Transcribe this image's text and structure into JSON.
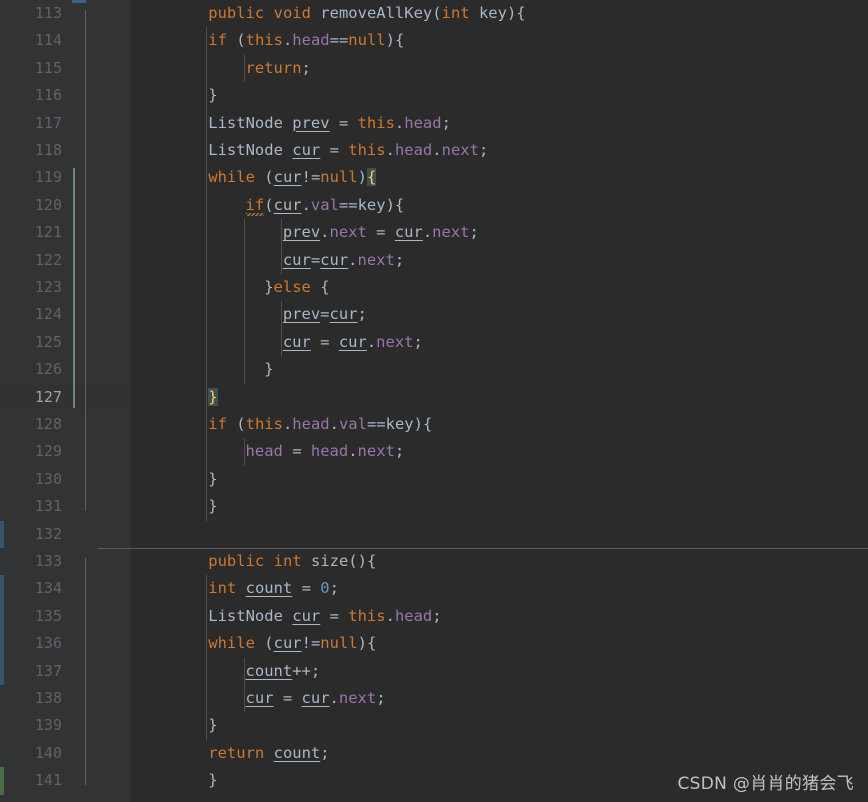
{
  "editor": {
    "app": "code-editor",
    "theme": "darcula",
    "font_size_px": 15.5,
    "line_height_px": 27.4,
    "first_line": 113,
    "last_line": 141,
    "current_line": 127,
    "colors": {
      "background": "#2b2b2b",
      "gutter_background": "#313335",
      "current_line_background": "#323232",
      "line_number": "#606366",
      "line_number_active": "#a4a3a3",
      "keyword": "#cc7832",
      "identifier": "#a9b7c6",
      "field": "#9876aa",
      "number": "#6897bb",
      "brace_match_bg": "#3b514d",
      "brace_match_fg": "#ffc66d",
      "indent_guide": "#4b4f52",
      "method_separator": "#5a5c5e",
      "change_marker_blue": "#385570",
      "change_marker_green": "#4a6b41",
      "watermark": "#cfcfcf"
    }
  },
  "watermark": {
    "text": "CSDN @肖肖的猪会飞"
  },
  "lines": [
    {
      "number": 113,
      "indent": 4,
      "fold": "start",
      "text": "public void removeAllKey(int key){",
      "tokens": [
        {
          "t": "public",
          "c": "kw"
        },
        {
          "t": " ",
          "c": "punct"
        },
        {
          "t": "void",
          "c": "kw"
        },
        {
          "t": " ",
          "c": "punct"
        },
        {
          "t": "removeAllKey",
          "c": "method"
        },
        {
          "t": "(",
          "c": "punct"
        },
        {
          "t": "int",
          "c": "kw"
        },
        {
          "t": " ",
          "c": "punct"
        },
        {
          "t": "key",
          "c": "param"
        },
        {
          "t": "){",
          "c": "punct"
        }
      ]
    },
    {
      "number": 114,
      "indent": 4,
      "fold": "start",
      "text": "if (this.head==null){",
      "tokens": [
        {
          "t": "if",
          "c": "kw"
        },
        {
          "t": " (",
          "c": "punct"
        },
        {
          "t": "this",
          "c": "kw"
        },
        {
          "t": ".",
          "c": "punct"
        },
        {
          "t": "head",
          "c": "field"
        },
        {
          "t": "==",
          "c": "punct"
        },
        {
          "t": "null",
          "c": "kw"
        },
        {
          "t": "){",
          "c": "punct"
        }
      ]
    },
    {
      "number": 115,
      "indent": 8,
      "fold": "none",
      "text": "return;",
      "tokens": [
        {
          "t": "return",
          "c": "kw"
        },
        {
          "t": ";",
          "c": "punct"
        }
      ]
    },
    {
      "number": 116,
      "indent": 4,
      "fold": "end",
      "text": "}",
      "tokens": [
        {
          "t": "}",
          "c": "punct"
        }
      ]
    },
    {
      "number": 117,
      "indent": 4,
      "fold": "none",
      "text": "ListNode prev = this.head;",
      "tokens": [
        {
          "t": "ListNode",
          "c": "type"
        },
        {
          "t": " ",
          "c": "punct"
        },
        {
          "t": "prev",
          "c": "localvar"
        },
        {
          "t": " = ",
          "c": "punct"
        },
        {
          "t": "this",
          "c": "kw"
        },
        {
          "t": ".",
          "c": "punct"
        },
        {
          "t": "head",
          "c": "field"
        },
        {
          "t": ";",
          "c": "punct"
        }
      ]
    },
    {
      "number": 118,
      "indent": 4,
      "fold": "none",
      "text": "ListNode cur = this.head.next;",
      "tokens": [
        {
          "t": "ListNode",
          "c": "type"
        },
        {
          "t": " ",
          "c": "punct"
        },
        {
          "t": "cur",
          "c": "localvar"
        },
        {
          "t": " = ",
          "c": "punct"
        },
        {
          "t": "this",
          "c": "kw"
        },
        {
          "t": ".",
          "c": "punct"
        },
        {
          "t": "head",
          "c": "field"
        },
        {
          "t": ".",
          "c": "punct"
        },
        {
          "t": "next",
          "c": "field"
        },
        {
          "t": ";",
          "c": "punct"
        }
      ]
    },
    {
      "number": 119,
      "indent": 4,
      "fold": "start",
      "text": "while (cur!=null){",
      "tokens": [
        {
          "t": "while",
          "c": "kw"
        },
        {
          "t": " (",
          "c": "punct"
        },
        {
          "t": "cur",
          "c": "localvar"
        },
        {
          "t": "!=",
          "c": "punct"
        },
        {
          "t": "null",
          "c": "kw"
        },
        {
          "t": ")",
          "c": "punct"
        },
        {
          "t": "{",
          "c": "brace-hl"
        }
      ]
    },
    {
      "number": 120,
      "indent": 8,
      "fold": "start",
      "text": "if(cur.val==key){",
      "tokens": [
        {
          "t": "if",
          "c": "warn"
        },
        {
          "t": "(",
          "c": "punct"
        },
        {
          "t": "cur",
          "c": "localvar"
        },
        {
          "t": ".",
          "c": "punct"
        },
        {
          "t": "val",
          "c": "field"
        },
        {
          "t": "==",
          "c": "punct"
        },
        {
          "t": "key",
          "c": "param"
        },
        {
          "t": "){",
          "c": "punct"
        }
      ]
    },
    {
      "number": 121,
      "indent": 12,
      "fold": "none",
      "text": "prev.next = cur.next;",
      "tokens": [
        {
          "t": "prev",
          "c": "localvar"
        },
        {
          "t": ".",
          "c": "punct"
        },
        {
          "t": "next",
          "c": "field"
        },
        {
          "t": " = ",
          "c": "punct"
        },
        {
          "t": "cur",
          "c": "localvar"
        },
        {
          "t": ".",
          "c": "punct"
        },
        {
          "t": "next",
          "c": "field"
        },
        {
          "t": ";",
          "c": "punct"
        }
      ]
    },
    {
      "number": 122,
      "indent": 12,
      "fold": "none",
      "text": "cur=cur.next;",
      "tokens": [
        {
          "t": "cur",
          "c": "localvar"
        },
        {
          "t": "=",
          "c": "punct"
        },
        {
          "t": "cur",
          "c": "localvar"
        },
        {
          "t": ".",
          "c": "punct"
        },
        {
          "t": "next",
          "c": "field"
        },
        {
          "t": ";",
          "c": "punct"
        }
      ]
    },
    {
      "number": 123,
      "indent": 10,
      "fold": "end",
      "text": "}else {",
      "tokens": [
        {
          "t": "}",
          "c": "punct"
        },
        {
          "t": "else",
          "c": "kw"
        },
        {
          "t": " {",
          "c": "punct"
        }
      ]
    },
    {
      "number": 124,
      "indent": 12,
      "fold": "none",
      "text": "prev=cur;",
      "tokens": [
        {
          "t": "prev",
          "c": "localvar"
        },
        {
          "t": "=",
          "c": "punct"
        },
        {
          "t": "cur",
          "c": "localvar"
        },
        {
          "t": ";",
          "c": "punct"
        }
      ]
    },
    {
      "number": 125,
      "indent": 12,
      "fold": "none",
      "text": "cur = cur.next;",
      "tokens": [
        {
          "t": "cur",
          "c": "localvar"
        },
        {
          "t": " = ",
          "c": "punct"
        },
        {
          "t": "cur",
          "c": "localvar"
        },
        {
          "t": ".",
          "c": "punct"
        },
        {
          "t": "next",
          "c": "field"
        },
        {
          "t": ";",
          "c": "punct"
        }
      ]
    },
    {
      "number": 126,
      "indent": 10,
      "fold": "end",
      "text": "}",
      "tokens": [
        {
          "t": "}",
          "c": "punct"
        }
      ]
    },
    {
      "number": 127,
      "indent": 4,
      "fold": "end",
      "current": true,
      "text": "}",
      "tokens": [
        {
          "t": "}",
          "c": "brace-hl"
        }
      ]
    },
    {
      "number": 128,
      "indent": 4,
      "fold": "start",
      "text": "if (this.head.val==key){",
      "tokens": [
        {
          "t": "if",
          "c": "kw"
        },
        {
          "t": " (",
          "c": "punct"
        },
        {
          "t": "this",
          "c": "kw"
        },
        {
          "t": ".",
          "c": "punct"
        },
        {
          "t": "head",
          "c": "field"
        },
        {
          "t": ".",
          "c": "punct"
        },
        {
          "t": "val",
          "c": "field"
        },
        {
          "t": "==",
          "c": "punct"
        },
        {
          "t": "key",
          "c": "param"
        },
        {
          "t": "){",
          "c": "punct"
        }
      ]
    },
    {
      "number": 129,
      "indent": 8,
      "fold": "none",
      "text": "head = head.next;",
      "tokens": [
        {
          "t": "head",
          "c": "field"
        },
        {
          "t": " = ",
          "c": "punct"
        },
        {
          "t": "head",
          "c": "field"
        },
        {
          "t": ".",
          "c": "punct"
        },
        {
          "t": "next",
          "c": "field"
        },
        {
          "t": ";",
          "c": "punct"
        }
      ]
    },
    {
      "number": 130,
      "indent": 4,
      "fold": "end",
      "text": "}",
      "tokens": [
        {
          "t": "}",
          "c": "punct"
        }
      ]
    },
    {
      "number": 131,
      "indent": 4,
      "fold": "end",
      "text": "}",
      "tokens": [
        {
          "t": "}",
          "c": "punct"
        }
      ]
    },
    {
      "number": 132,
      "indent": 0,
      "fold": "none",
      "change": "blue",
      "text": "",
      "tokens": []
    },
    {
      "number": 133,
      "indent": 4,
      "fold": "start",
      "separator_above": true,
      "text": "public int size(){",
      "tokens": [
        {
          "t": "public",
          "c": "kw"
        },
        {
          "t": " ",
          "c": "punct"
        },
        {
          "t": "int",
          "c": "kw"
        },
        {
          "t": " ",
          "c": "punct"
        },
        {
          "t": "size",
          "c": "method"
        },
        {
          "t": "(){",
          "c": "punct"
        }
      ]
    },
    {
      "number": 134,
      "indent": 4,
      "fold": "none",
      "change": "blue",
      "text": "int count = 0;",
      "tokens": [
        {
          "t": "int",
          "c": "kw"
        },
        {
          "t": " ",
          "c": "punct"
        },
        {
          "t": "count",
          "c": "localvar"
        },
        {
          "t": " = ",
          "c": "punct"
        },
        {
          "t": "0",
          "c": "num-lit"
        },
        {
          "t": ";",
          "c": "punct"
        }
      ]
    },
    {
      "number": 135,
      "indent": 4,
      "fold": "none",
      "change": "blue",
      "text": "ListNode cur = this.head;",
      "tokens": [
        {
          "t": "ListNode",
          "c": "type"
        },
        {
          "t": " ",
          "c": "punct"
        },
        {
          "t": "cur",
          "c": "localvar"
        },
        {
          "t": " = ",
          "c": "punct"
        },
        {
          "t": "this",
          "c": "kw"
        },
        {
          "t": ".",
          "c": "punct"
        },
        {
          "t": "head",
          "c": "field"
        },
        {
          "t": ";",
          "c": "punct"
        }
      ]
    },
    {
      "number": 136,
      "indent": 4,
      "fold": "start",
      "change": "blue",
      "text": "while (cur!=null){",
      "tokens": [
        {
          "t": "while",
          "c": "kw"
        },
        {
          "t": " (",
          "c": "punct"
        },
        {
          "t": "cur",
          "c": "localvar"
        },
        {
          "t": "!=",
          "c": "punct"
        },
        {
          "t": "null",
          "c": "kw"
        },
        {
          "t": "){",
          "c": "punct"
        }
      ]
    },
    {
      "number": 137,
      "indent": 8,
      "fold": "none",
      "change": "blue",
      "text": "count++;",
      "tokens": [
        {
          "t": "count",
          "c": "localvar"
        },
        {
          "t": "++;",
          "c": "punct"
        }
      ]
    },
    {
      "number": 138,
      "indent": 8,
      "fold": "none",
      "text": "cur = cur.next;",
      "tokens": [
        {
          "t": "cur",
          "c": "localvar"
        },
        {
          "t": " = ",
          "c": "punct"
        },
        {
          "t": "cur",
          "c": "localvar"
        },
        {
          "t": ".",
          "c": "punct"
        },
        {
          "t": "next",
          "c": "field"
        },
        {
          "t": ";",
          "c": "punct"
        }
      ]
    },
    {
      "number": 139,
      "indent": 4,
      "fold": "end",
      "text": "}",
      "tokens": [
        {
          "t": "}",
          "c": "punct"
        }
      ]
    },
    {
      "number": 140,
      "indent": 4,
      "fold": "none",
      "text": "return count;",
      "tokens": [
        {
          "t": "return",
          "c": "kw"
        },
        {
          "t": " ",
          "c": "punct"
        },
        {
          "t": "count",
          "c": "localvar"
        },
        {
          "t": ";",
          "c": "punct"
        }
      ]
    },
    {
      "number": 141,
      "indent": 4,
      "fold": "end",
      "change": "green",
      "text": "}",
      "tokens": [
        {
          "t": "}",
          "c": "punct"
        }
      ]
    }
  ]
}
